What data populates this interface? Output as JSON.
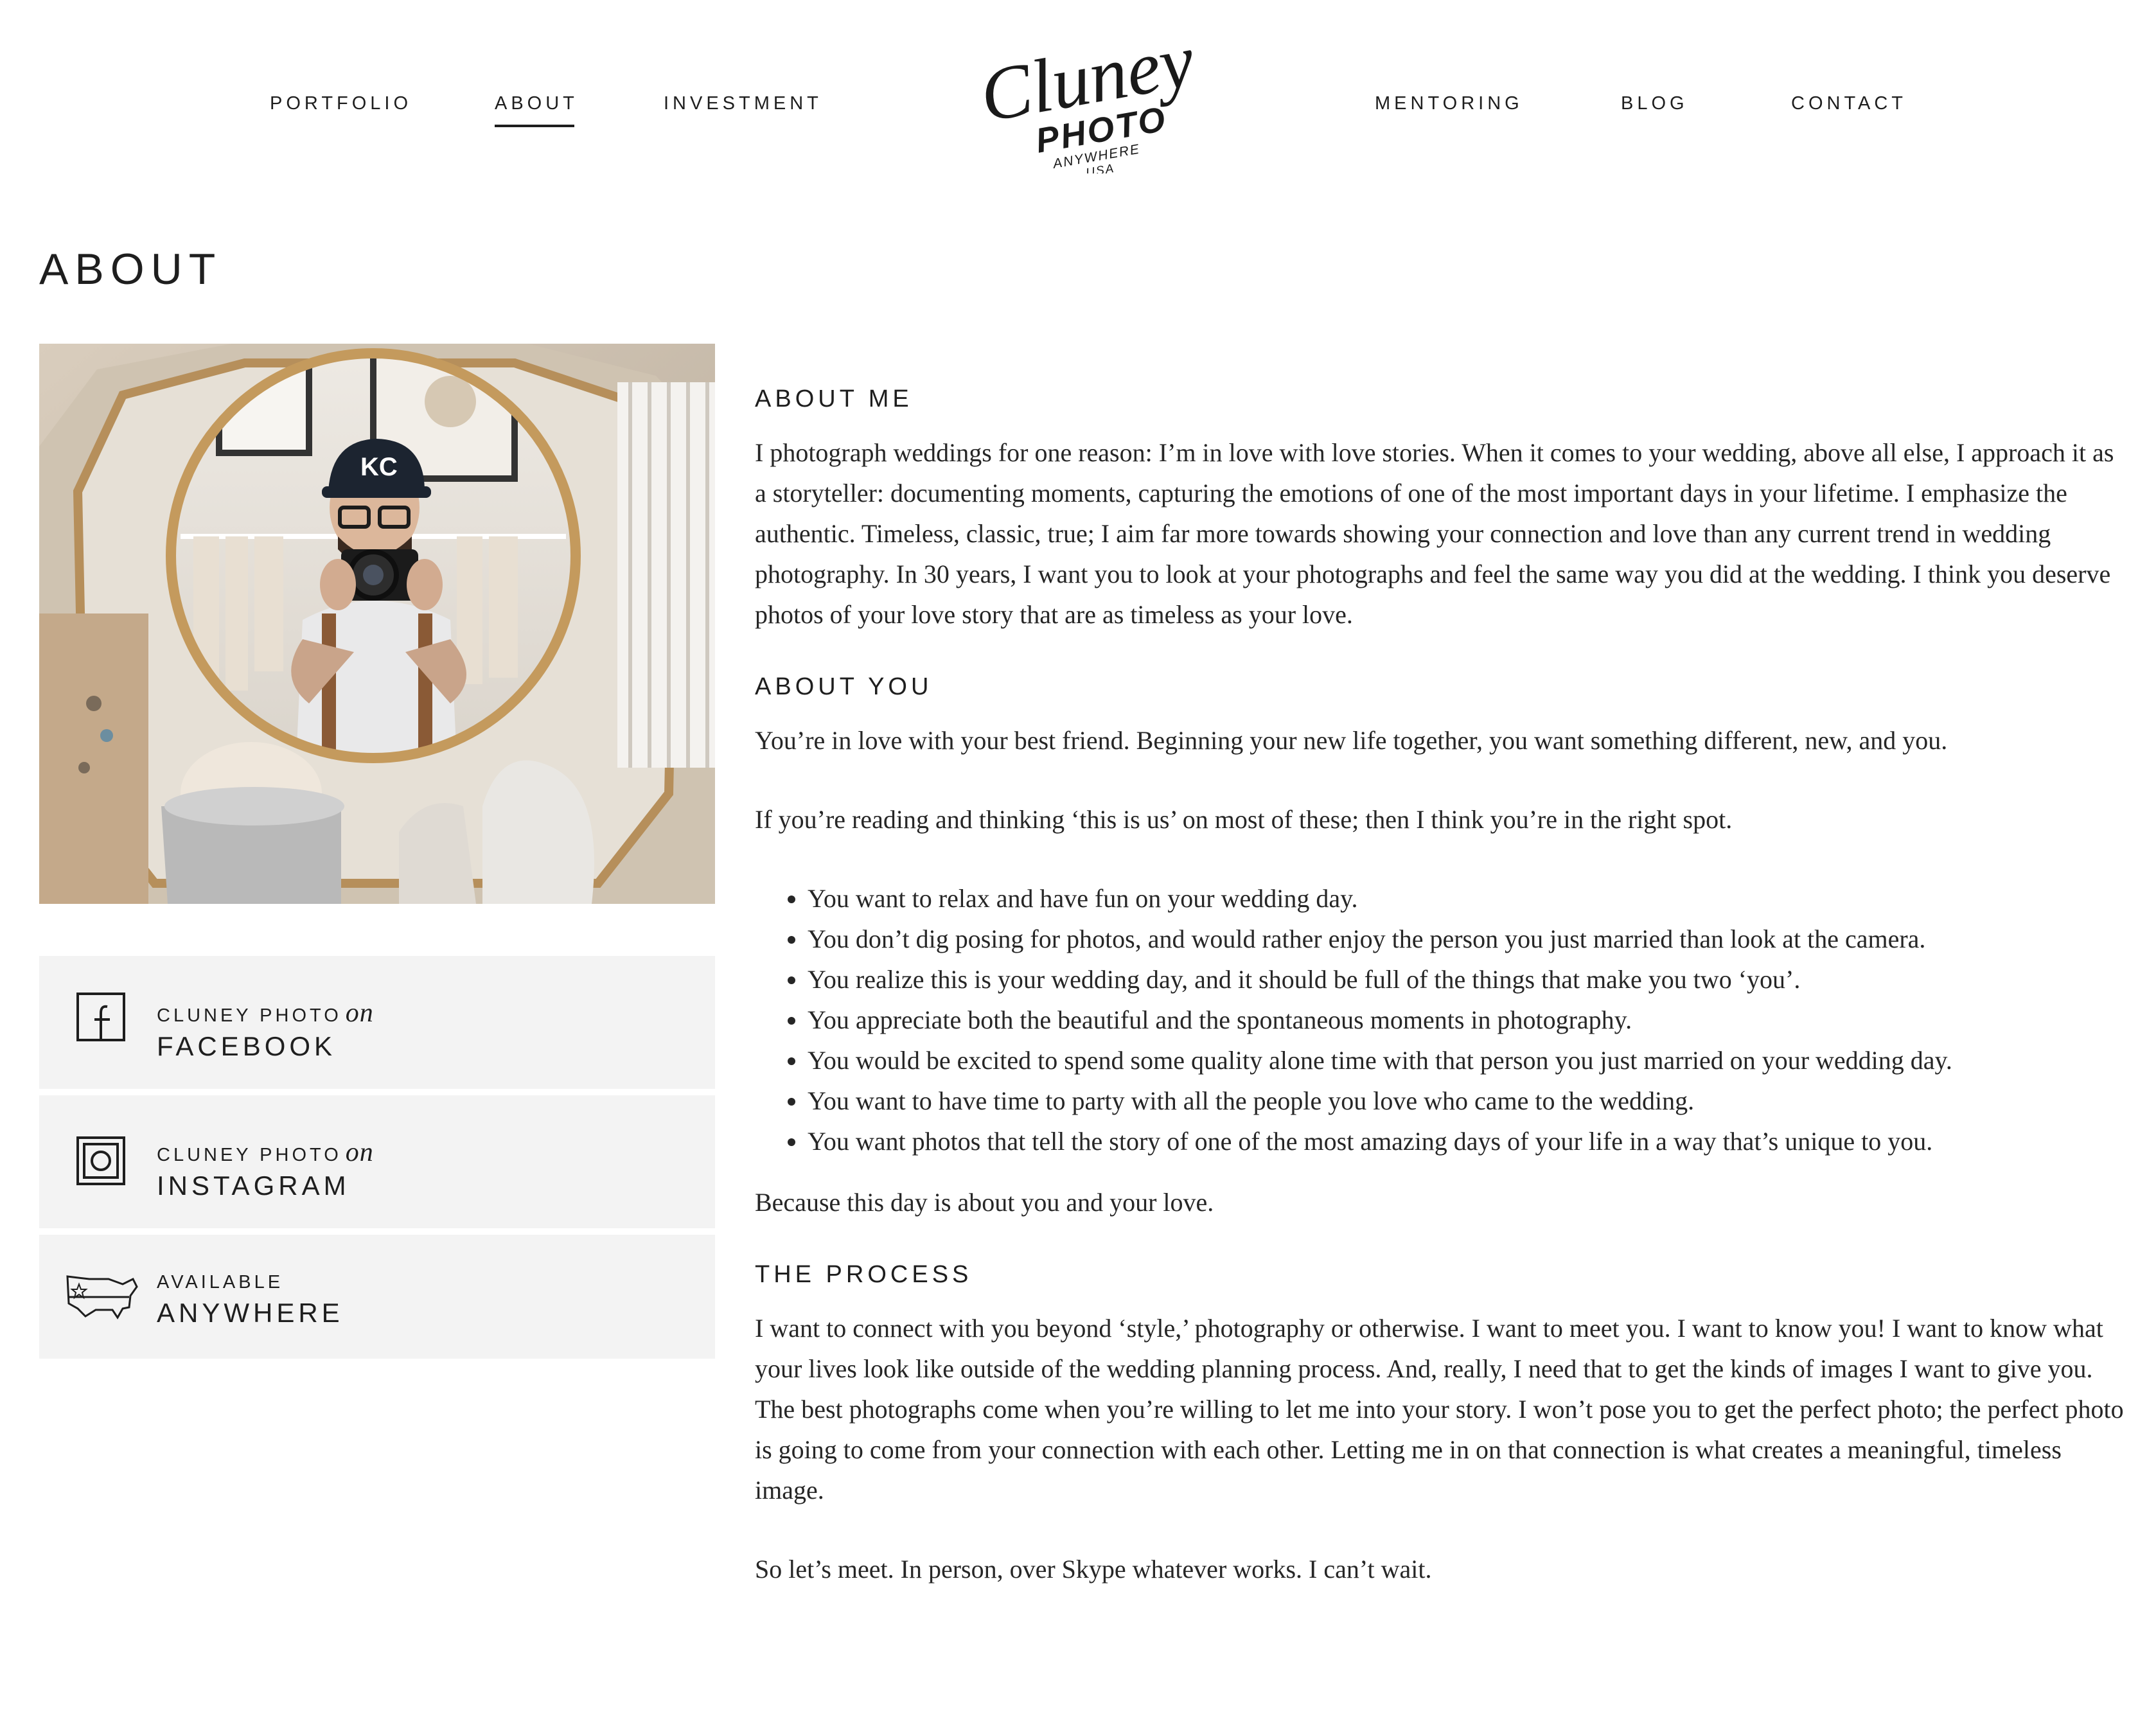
{
  "nav": {
    "left": [
      {
        "label": "PORTFOLIO"
      },
      {
        "label": "ABOUT"
      },
      {
        "label": "INVESTMENT"
      }
    ],
    "right": [
      {
        "label": "MENTORING"
      },
      {
        "label": "BLOG"
      },
      {
        "label": "CONTACT"
      }
    ],
    "active": "ABOUT"
  },
  "logo": {
    "script": "Cluney",
    "photo": "PHOTO",
    "anywhere": "ANYWHERE",
    "usa": "USA"
  },
  "page_title": "ABOUT",
  "photo": {
    "cap_text": "KC"
  },
  "social": [
    {
      "small": "CLUNEY PHOTO",
      "on": "on",
      "big": "FACEBOOK",
      "icon": "facebook-icon"
    },
    {
      "small": "CLUNEY PHOTO",
      "on": "on",
      "big": "INSTAGRAM",
      "icon": "instagram-icon"
    },
    {
      "small": "AVAILABLE",
      "on": "",
      "big": "ANYWHERE",
      "icon": "usa-map-icon"
    }
  ],
  "about_me": {
    "heading": "ABOUT ME",
    "body": "I photograph weddings for one reason: I’m in love with love stories. When it comes to your wedding, above all else, I approach it as a storyteller: documenting moments, capturing the emotions of one of the most important days in your lifetime. I emphasize the authentic. Timeless, classic, true; I aim far more towards showing your connection and love than any current trend in wedding photography. In 30 years, I want you to look at your photographs and feel the same way you did at the wedding. I think you deserve photos of your love story that are as timeless as your love."
  },
  "about_you": {
    "heading": "ABOUT YOU",
    "p1": "You’re in love with your best friend.  Beginning your new life together, you want something different, new, and you.",
    "p2": "If you’re reading and thinking ‘this is us’ on most of these; then I think you’re in the right spot.",
    "bullets": [
      "You want to relax and have fun on your wedding day.",
      "You don’t dig posing for photos, and would rather enjoy the person you just married than look at the camera.",
      "You realize this is your wedding day, and it should be full of the things that make you two ‘you’.",
      "You appreciate both the beautiful and the spontaneous moments in photography.",
      "You would be excited to spend some quality alone time with that person you just married on your wedding day.",
      "You want to have time to party with all the people you love who came to the wedding.",
      "You want photos that tell the story of one of the most amazing days of your life in a way that’s unique to you."
    ],
    "closing": "Because this day is about you and your love."
  },
  "process": {
    "heading": "THE PROCESS",
    "p1": "I want to connect with you beyond ‘style,’ photography or otherwise. I want to meet you. I want to know you! I want to know what your lives look like outside of the wedding planning process. And, really, I need that to get the kinds of images I want to give you. The best photographs come when you’re willing to let me into your story. I won’t pose you to get the perfect photo; the perfect photo is going to come from your connection with each other. Letting me in on that connection is what creates a meaningful, timeless image.",
    "p2": "So let’s meet. In person, over Skype whatever works. I can’t wait."
  }
}
